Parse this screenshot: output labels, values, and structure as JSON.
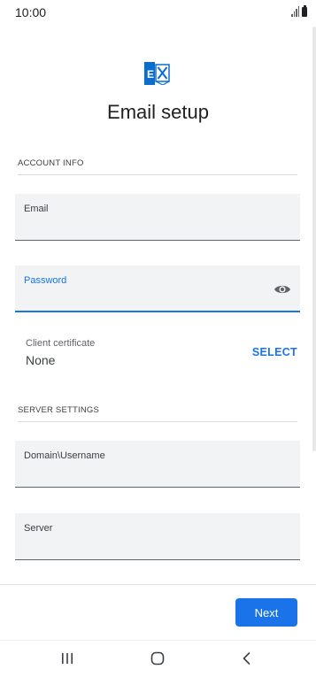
{
  "status_bar": {
    "time": "10:00"
  },
  "header": {
    "logo_icon": "exchange-logo-icon",
    "title": "Email setup"
  },
  "account_info": {
    "section_label": "ACCOUNT INFO",
    "email": {
      "label": "Email",
      "value": ""
    },
    "password": {
      "label": "Password",
      "value": "",
      "toggle_icon": "eye-icon"
    }
  },
  "certificate": {
    "label": "Client certificate",
    "value": "None",
    "action": "SELECT"
  },
  "server_settings": {
    "section_label": "SERVER SETTINGS",
    "domain_username": {
      "label": "Domain\\Username",
      "value": ""
    },
    "server": {
      "label": "Server",
      "value": ""
    }
  },
  "footer": {
    "next_label": "Next"
  },
  "nav_bar": {
    "recents_icon": "recents-icon",
    "home_icon": "home-icon",
    "back_icon": "back-icon"
  },
  "colors": {
    "accent": "#1a73e8",
    "field_background": "#f1f3f4",
    "logo_blue": "#0a6ed1"
  }
}
